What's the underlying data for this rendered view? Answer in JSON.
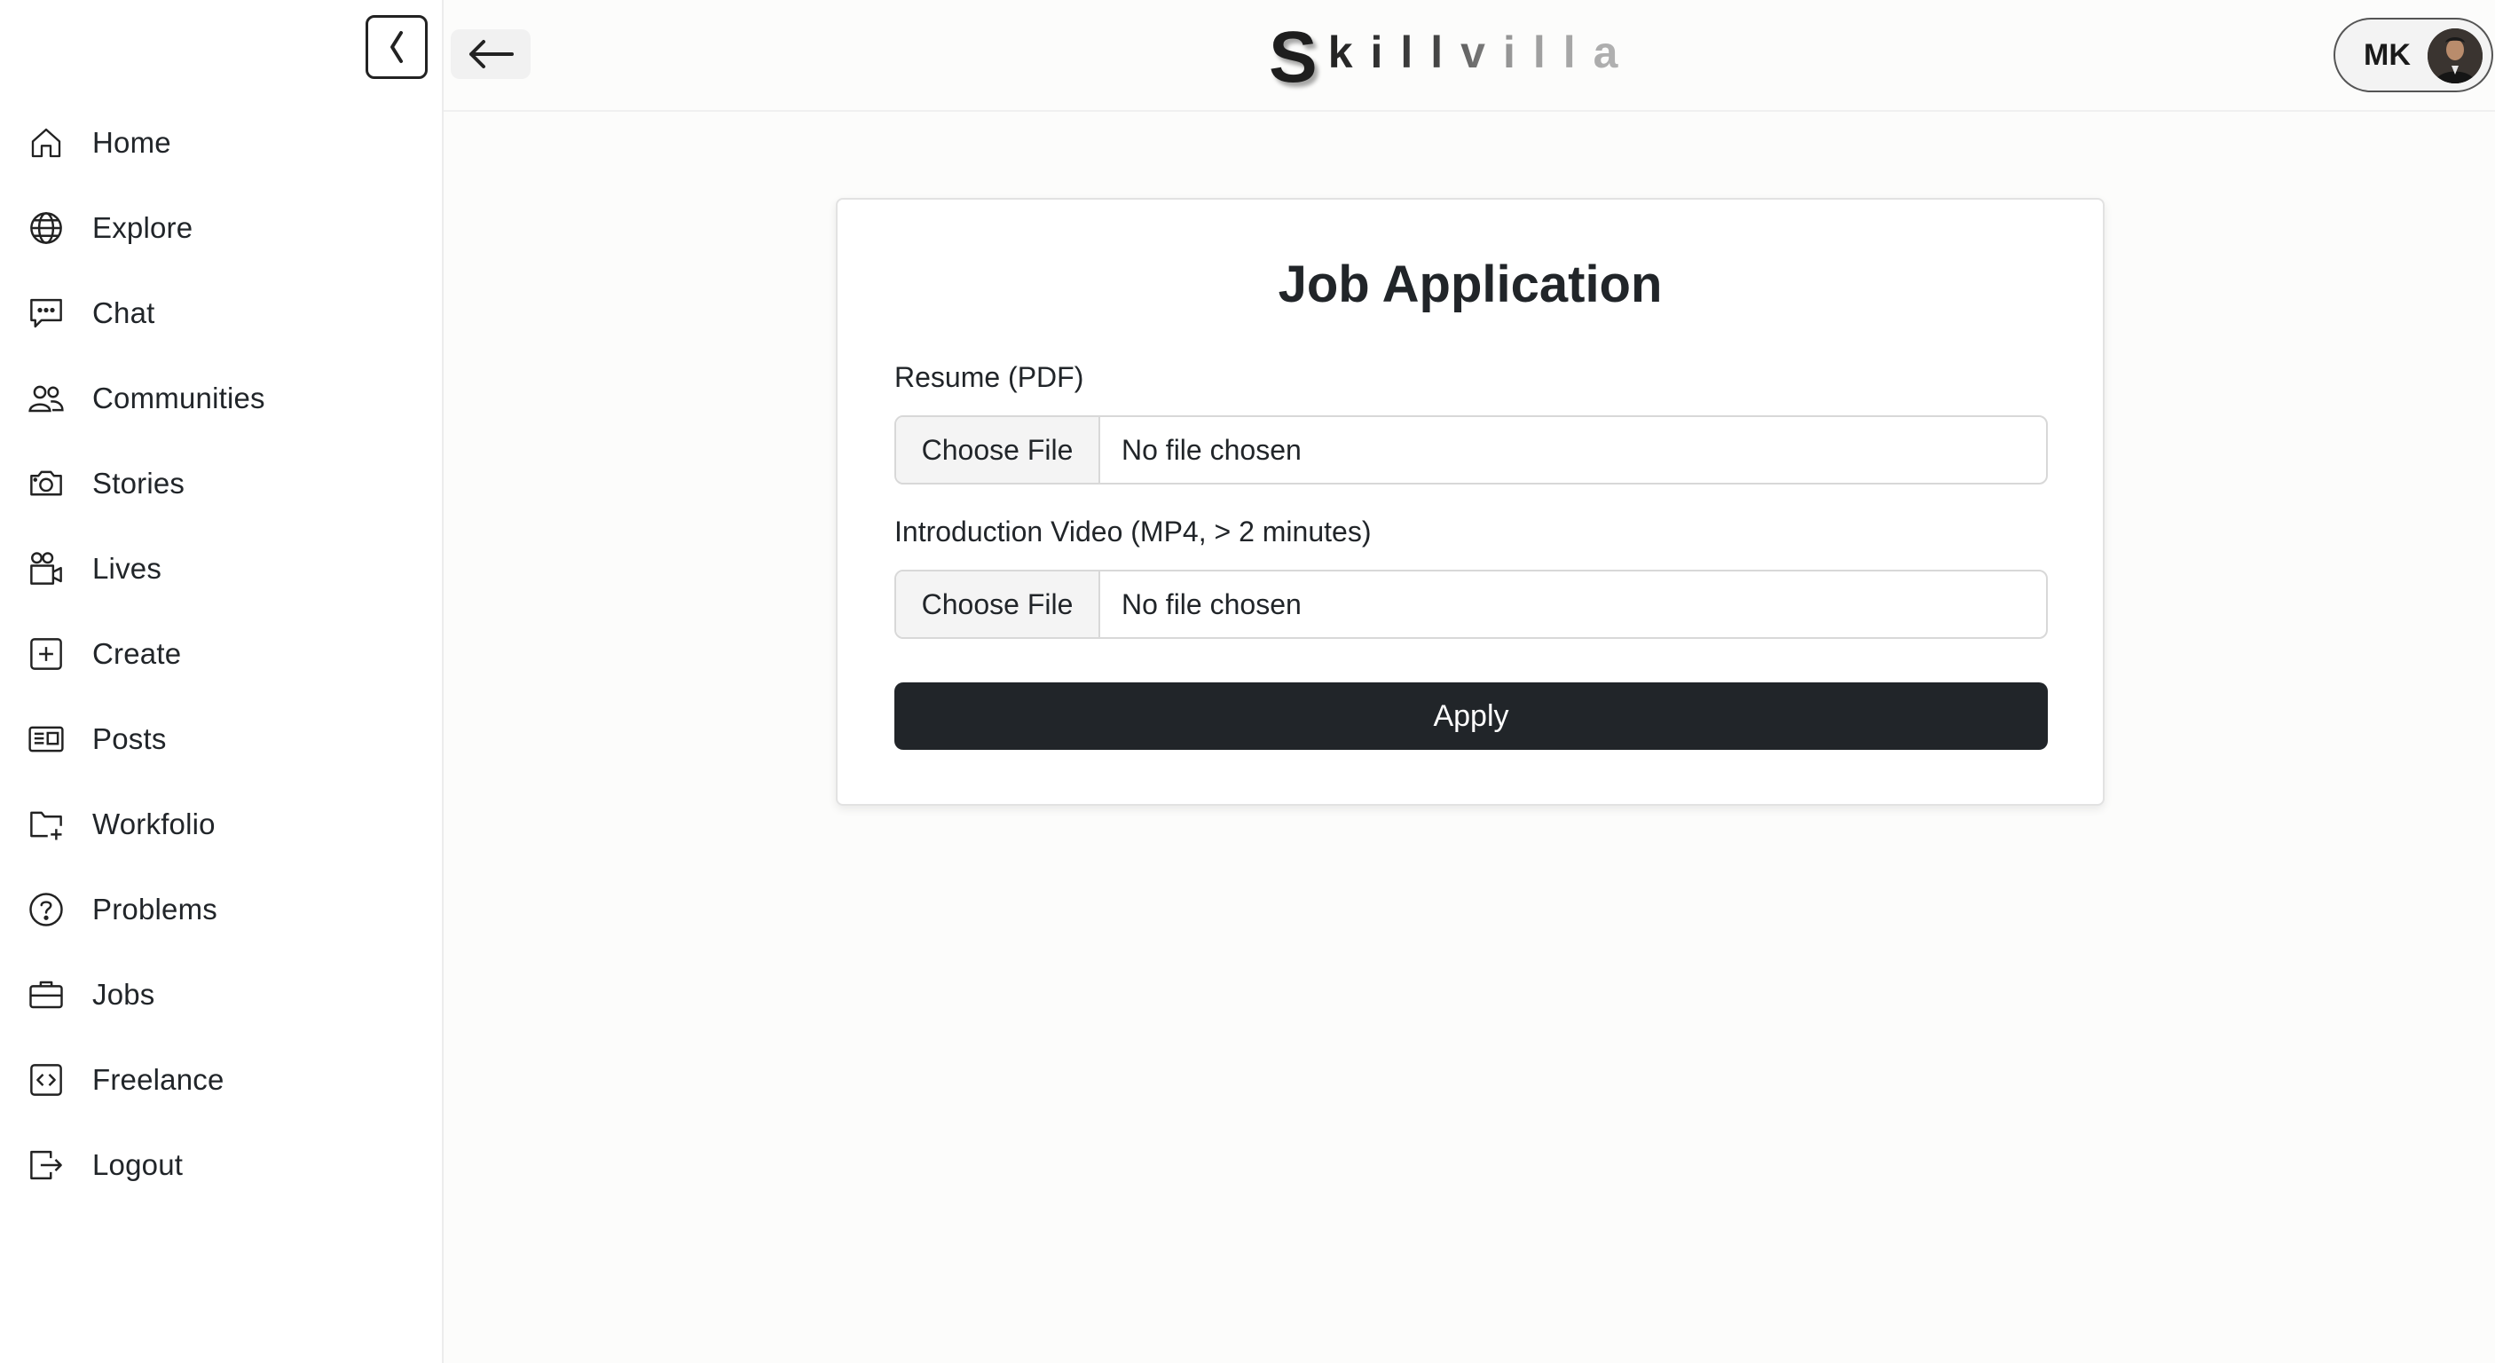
{
  "app": {
    "logo_s": "S",
    "logo_rest": "killvilla"
  },
  "sidebar": {
    "items": [
      {
        "label": "Home",
        "icon": "home-icon"
      },
      {
        "label": "Explore",
        "icon": "globe-icon"
      },
      {
        "label": "Chat",
        "icon": "chat-icon"
      },
      {
        "label": "Communities",
        "icon": "users-icon"
      },
      {
        "label": "Stories",
        "icon": "camera-icon"
      },
      {
        "label": "Lives",
        "icon": "video-camera-icon"
      },
      {
        "label": "Create",
        "icon": "plus-square-icon"
      },
      {
        "label": "Posts",
        "icon": "newspaper-icon"
      },
      {
        "label": "Workfolio",
        "icon": "folder-plus-icon"
      },
      {
        "label": "Problems",
        "icon": "question-circle-icon"
      },
      {
        "label": "Jobs",
        "icon": "briefcase-icon"
      },
      {
        "label": "Freelance",
        "icon": "code-square-icon"
      },
      {
        "label": "Logout",
        "icon": "logout-icon"
      }
    ]
  },
  "header": {
    "profile_initials": "MK"
  },
  "form": {
    "title": "Job Application",
    "resume": {
      "label": "Resume (PDF)",
      "button": "Choose File",
      "status": "No file chosen"
    },
    "video": {
      "label": "Introduction Video (MP4, > 2 minutes)",
      "button": "Choose File",
      "status": "No file chosen"
    },
    "submit_label": "Apply"
  },
  "colors": {
    "primary_button": "#212529",
    "background": "#fcfcfb"
  }
}
